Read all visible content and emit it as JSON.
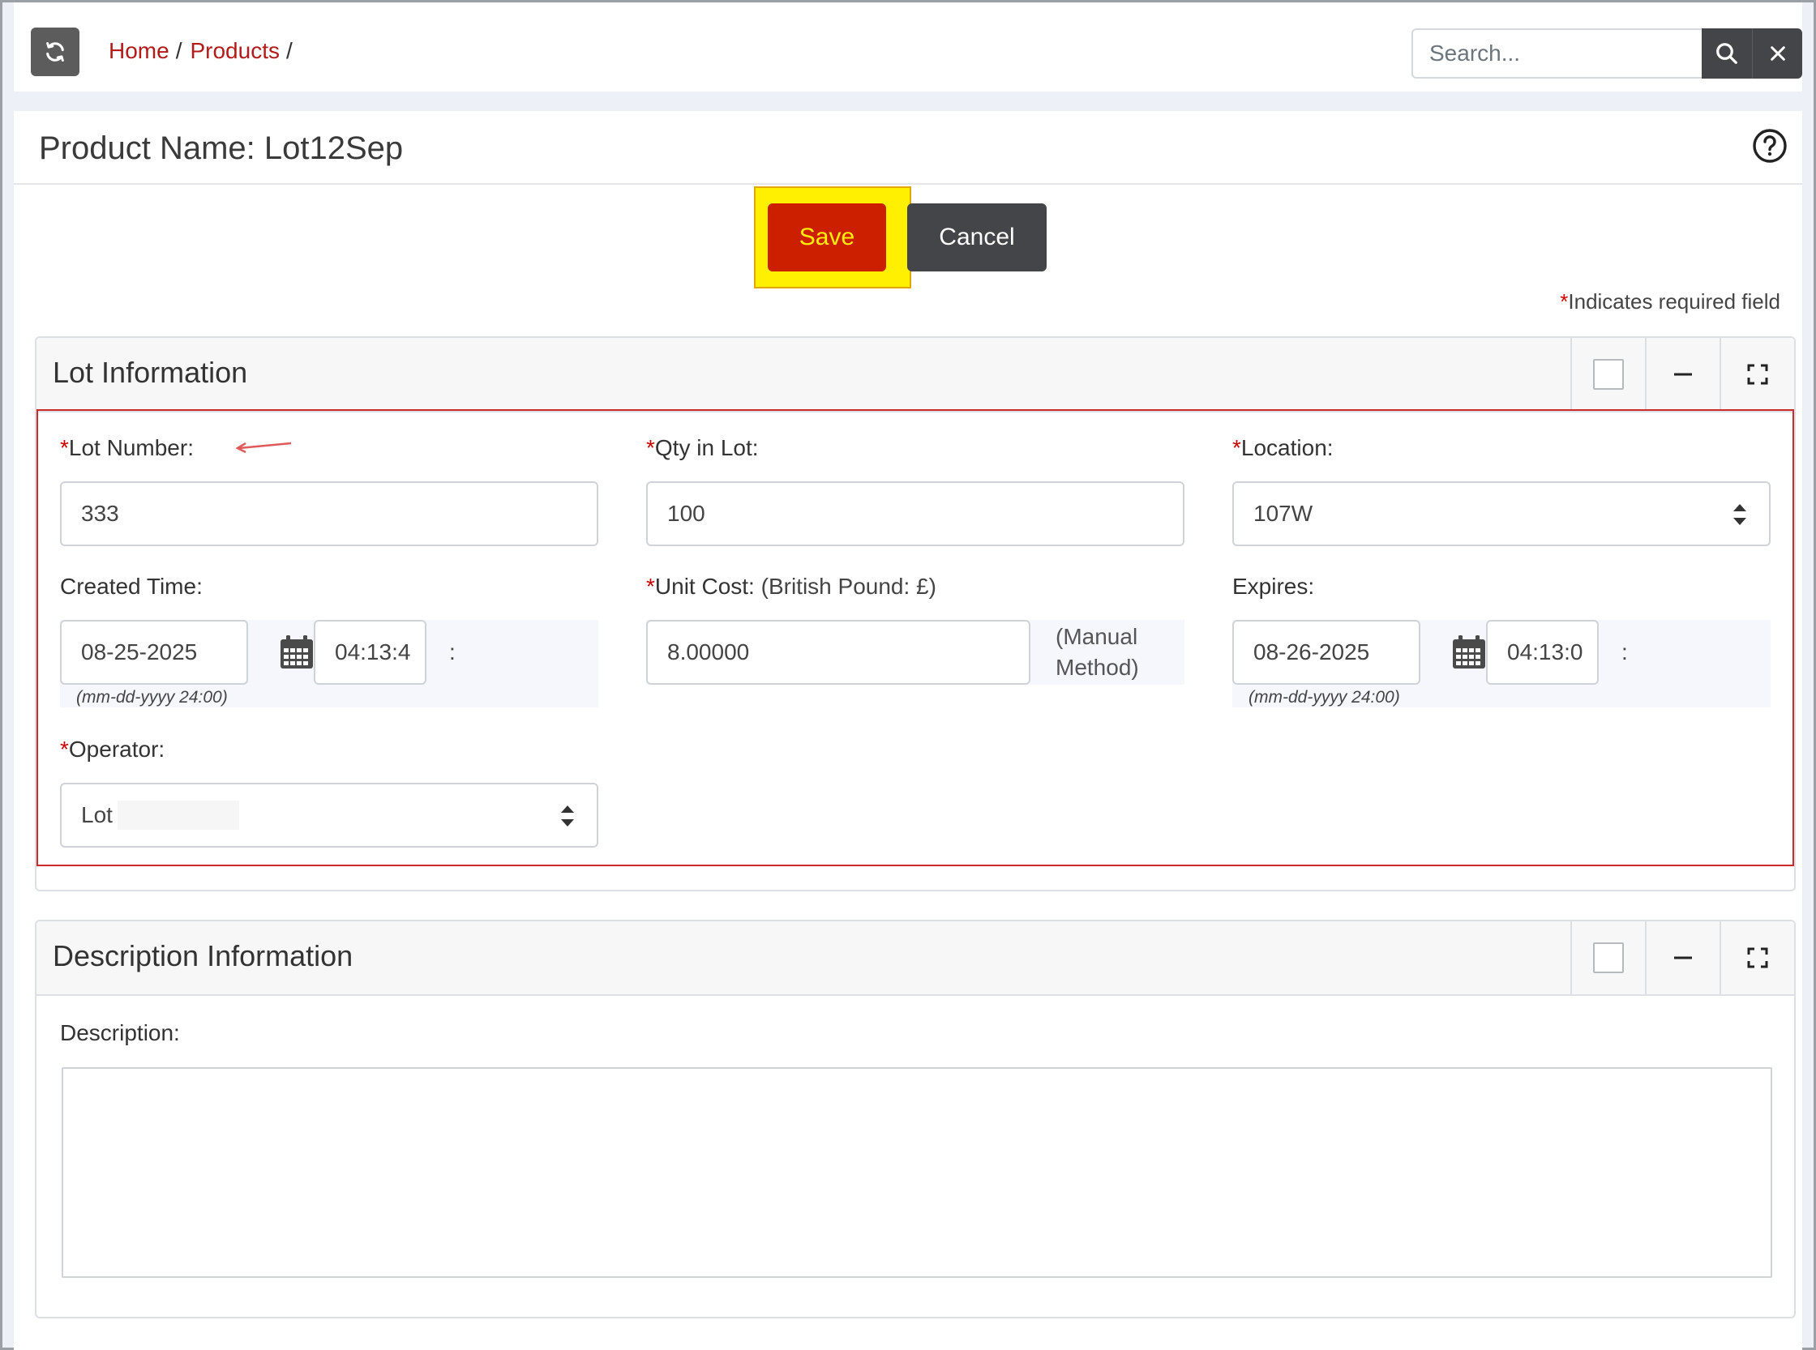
{
  "header": {
    "breadcrumb": [
      {
        "label": "Home",
        "sep": "/"
      },
      {
        "label": "Products",
        "sep": "/"
      }
    ],
    "search": {
      "placeholder": "Search...",
      "value": ""
    },
    "icons": {
      "refresh": "refresh-icon",
      "search": "search-icon",
      "clear": "close-icon"
    }
  },
  "page": {
    "title": "Product Name: Lot12Sep",
    "save_label": "Save",
    "cancel_label": "Cancel",
    "required_note_star": "*",
    "required_note": "Indicates required field"
  },
  "lot_info": {
    "title": "Lot Information",
    "lot_number": {
      "label": "Lot Number:",
      "req": "*",
      "value": "333"
    },
    "qty": {
      "label": "Qty in Lot:",
      "req": "*",
      "value": "100"
    },
    "location": {
      "label": "Location:",
      "req": "*",
      "value": "107W"
    },
    "created": {
      "label": "Created Time:",
      "date": "08-25-2025",
      "time": "04:13:4",
      "colon": ":",
      "hint": "(mm-dd-yyyy 24:00)"
    },
    "unit_cost": {
      "label": "Unit Cost:",
      "req": "*",
      "currency": " (British Pound: £)",
      "value": "8.00000",
      "method_line1": "(Manual",
      "method_line2": "Method)"
    },
    "expires": {
      "label": "Expires:",
      "date": "08-26-2025",
      "time": "04:13:0",
      "colon": ":",
      "hint": "(mm-dd-yyyy 24:00)"
    },
    "operator": {
      "label": "Operator:",
      "req": "*",
      "value": "Lot"
    }
  },
  "desc_info": {
    "title": "Description Information",
    "description_label": "Description:",
    "description_value": ""
  },
  "colors": {
    "accent_red": "#cc1f00",
    "link_red": "#b31b1b",
    "save_text": "#ffee00",
    "highlight": "#ffef00",
    "dark_button": "#444548"
  }
}
